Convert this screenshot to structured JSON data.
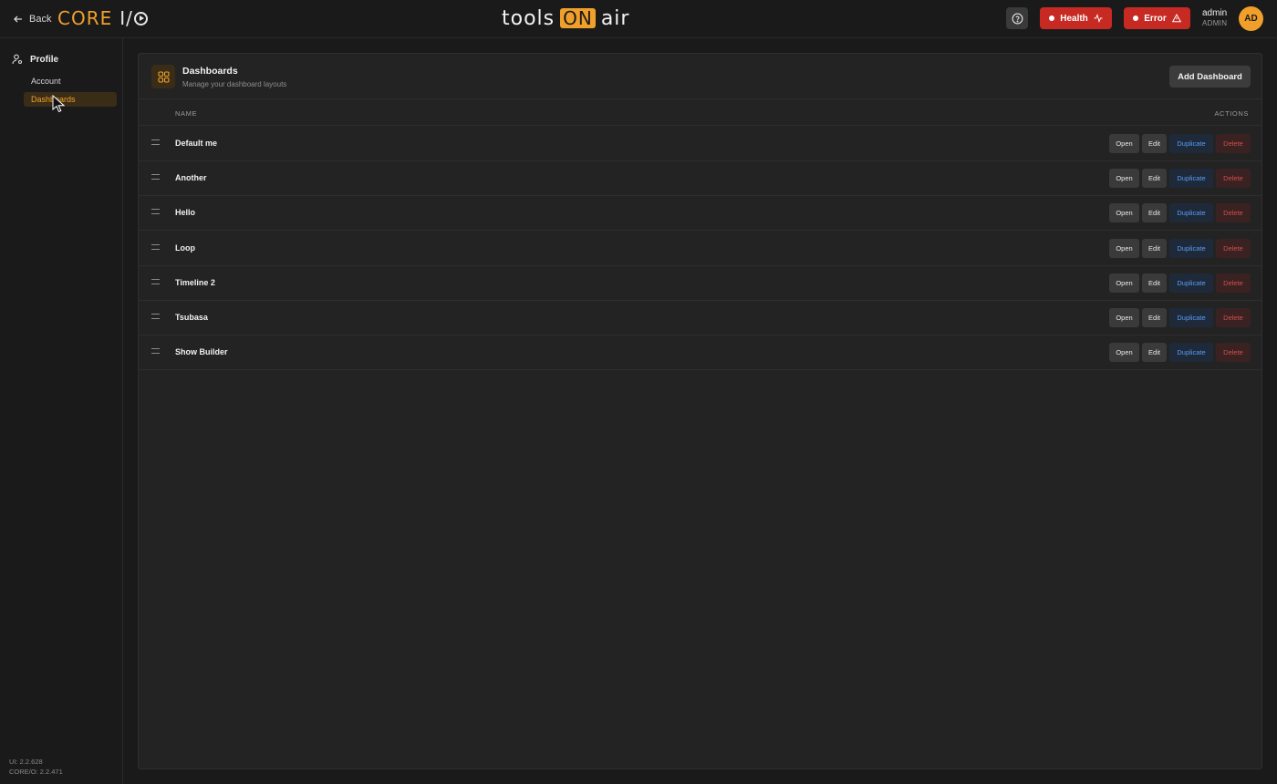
{
  "header": {
    "back_label": "Back",
    "core_logo": "CORE",
    "io_logo": "I/",
    "toa_left": "tools",
    "toa_on": "ON",
    "toa_right": "air",
    "health_label": "Health",
    "error_label": "Error",
    "user_name": "admin",
    "user_role": "ADMIN",
    "avatar_initials": "AD"
  },
  "sidebar": {
    "section_label": "Profile",
    "items": [
      {
        "label": "Account"
      },
      {
        "label": "Dashboards"
      }
    ],
    "version_ui": "UI: 2.2.628",
    "version_core": "CORE/O: 2.2.471"
  },
  "panel": {
    "title": "Dashboards",
    "subtitle": "Manage your dashboard layouts",
    "add_label": "Add Dashboard",
    "col_name": "NAME",
    "col_actions": "ACTIONS",
    "actions": {
      "open": "Open",
      "edit": "Edit",
      "duplicate": "Duplicate",
      "delete": "Delete"
    },
    "rows": [
      {
        "name": "Default me"
      },
      {
        "name": "Another"
      },
      {
        "name": "Hello"
      },
      {
        "name": "Loop"
      },
      {
        "name": "Timeline 2"
      },
      {
        "name": "Tsubasa"
      },
      {
        "name": "Show Builder"
      }
    ]
  },
  "colors": {
    "accent": "#f0a02a",
    "danger": "#c62a22",
    "link_blue": "#5a9cf5"
  }
}
